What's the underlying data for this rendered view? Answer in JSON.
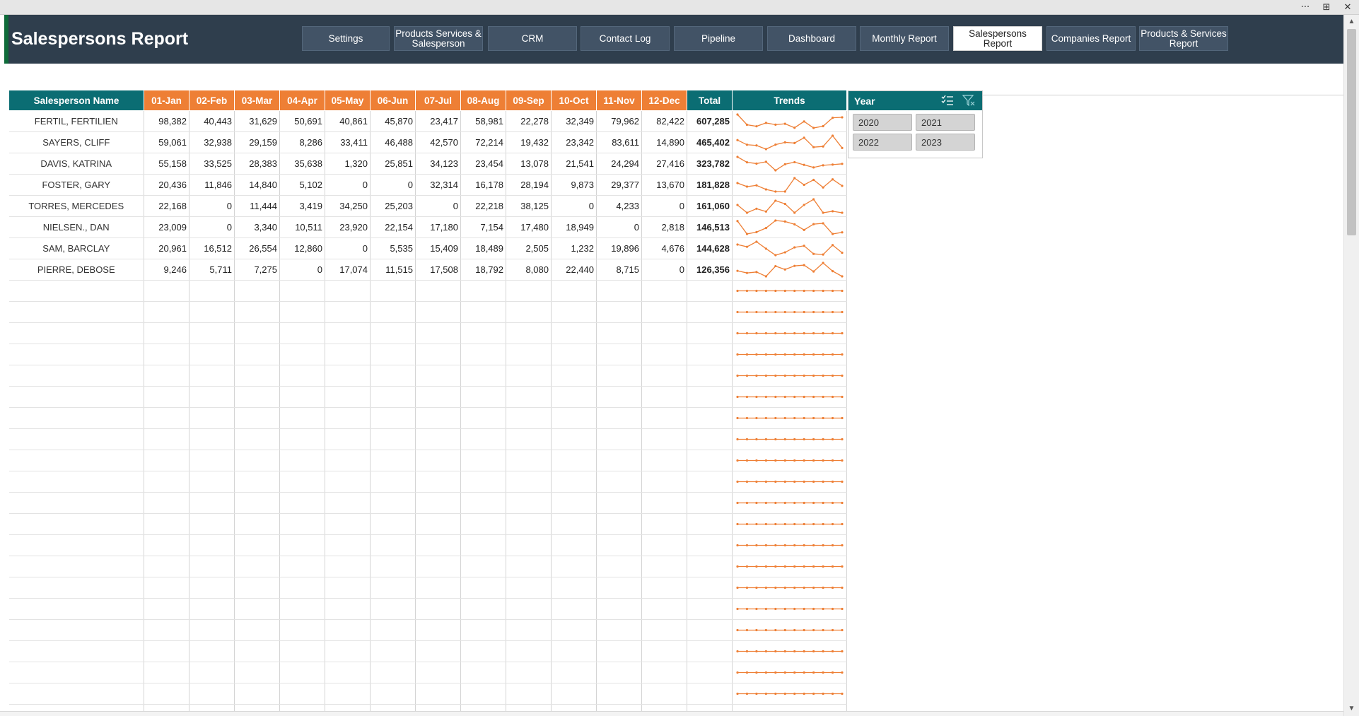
{
  "window": {
    "controls": [
      "···",
      "⊞",
      "✕"
    ]
  },
  "header": {
    "title": "Salespersons Report",
    "nav": [
      {
        "label": "Settings",
        "active": false
      },
      {
        "label": "Products Services & Salesperson",
        "active": false
      },
      {
        "label": "CRM",
        "active": false
      },
      {
        "label": "Contact Log",
        "active": false
      },
      {
        "label": "Pipeline",
        "active": false
      },
      {
        "label": "Dashboard",
        "active": false
      },
      {
        "label": "Monthly Report",
        "active": false
      },
      {
        "label": "Salespersons Report",
        "active": true
      },
      {
        "label": "Companies Report",
        "active": false
      },
      {
        "label": "Products & Services Report",
        "active": false
      }
    ]
  },
  "table": {
    "headers": {
      "name": "Salesperson Name",
      "months": [
        "01-Jan",
        "02-Feb",
        "03-Mar",
        "04-Apr",
        "05-May",
        "06-Jun",
        "07-Jul",
        "08-Aug",
        "09-Sep",
        "10-Oct",
        "11-Nov",
        "12-Dec"
      ],
      "total": "Total",
      "trends": "Trends"
    },
    "rows": [
      {
        "name": "FERTIL, FERTILIEN",
        "values": [
          "98,382",
          "40,443",
          "31,629",
          "50,691",
          "40,861",
          "45,870",
          "23,417",
          "58,981",
          "22,278",
          "32,349",
          "79,962",
          "82,422"
        ],
        "total": "607,285",
        "trend": [
          98382,
          40443,
          31629,
          50691,
          40861,
          45870,
          23417,
          58981,
          22278,
          32349,
          79962,
          82422
        ]
      },
      {
        "name": "SAYERS, CLIFF",
        "values": [
          "59,061",
          "32,938",
          "29,159",
          "8,286",
          "33,411",
          "46,488",
          "42,570",
          "72,214",
          "19,432",
          "23,342",
          "83,611",
          "14,890"
        ],
        "total": "465,402",
        "trend": [
          59061,
          32938,
          29159,
          8286,
          33411,
          46488,
          42570,
          72214,
          19432,
          23342,
          83611,
          14890
        ]
      },
      {
        "name": "DAVIS, KATRINA",
        "values": [
          "55,158",
          "33,525",
          "28,383",
          "35,638",
          "1,320",
          "25,851",
          "34,123",
          "23,454",
          "13,078",
          "21,541",
          "24,294",
          "27,416"
        ],
        "total": "323,782",
        "trend": [
          55158,
          33525,
          28383,
          35638,
          1320,
          25851,
          34123,
          23454,
          13078,
          21541,
          24294,
          27416
        ]
      },
      {
        "name": "FOSTER, GARY",
        "values": [
          "20,436",
          "11,846",
          "14,840",
          "5,102",
          "0",
          "0",
          "32,314",
          "16,178",
          "28,194",
          "9,873",
          "29,377",
          "13,670"
        ],
        "total": "181,828",
        "trend": [
          20436,
          11846,
          14840,
          5102,
          0,
          0,
          32314,
          16178,
          28194,
          9873,
          29377,
          13670
        ]
      },
      {
        "name": "TORRES, MERCEDES",
        "values": [
          "22,168",
          "0",
          "11,444",
          "3,419",
          "34,250",
          "25,203",
          "0",
          "22,218",
          "38,125",
          "0",
          "4,233",
          "0"
        ],
        "total": "161,060",
        "trend": [
          22168,
          0,
          11444,
          3419,
          34250,
          25203,
          0,
          22218,
          38125,
          0,
          4233,
          0
        ]
      },
      {
        "name": "NIELSEN., DAN",
        "values": [
          "23,009",
          "0",
          "3,340",
          "10,511",
          "23,920",
          "22,154",
          "17,180",
          "7,154",
          "17,480",
          "18,949",
          "0",
          "2,818"
        ],
        "total": "146,513",
        "trend": [
          23009,
          0,
          3340,
          10511,
          23920,
          22154,
          17180,
          7154,
          17480,
          18949,
          0,
          2818
        ]
      },
      {
        "name": "SAM, BARCLAY",
        "values": [
          "20,961",
          "16,512",
          "26,554",
          "12,860",
          "0",
          "5,535",
          "15,409",
          "18,489",
          "2,505",
          "1,232",
          "19,896",
          "4,676"
        ],
        "total": "144,628",
        "trend": [
          20961,
          16512,
          26554,
          12860,
          0,
          5535,
          15409,
          18489,
          2505,
          1232,
          19896,
          4676
        ]
      },
      {
        "name": "PIERRE, DEBOSE",
        "values": [
          "9,246",
          "5,711",
          "7,275",
          "0",
          "17,074",
          "11,515",
          "17,508",
          "18,792",
          "8,080",
          "22,440",
          "8,715",
          "0"
        ],
        "total": "126,356",
        "trend": [
          9246,
          5711,
          7275,
          0,
          17074,
          11515,
          17508,
          18792,
          8080,
          22440,
          8715,
          0
        ]
      }
    ],
    "empty_rows": 22
  },
  "slicer": {
    "title": "Year",
    "items": [
      "2020",
      "2021",
      "2022",
      "2023"
    ]
  },
  "colors": {
    "banner": "#2f3e4d",
    "teal": "#0b6d73",
    "orange": "#ee7f35",
    "spark": "#ee7f35"
  }
}
